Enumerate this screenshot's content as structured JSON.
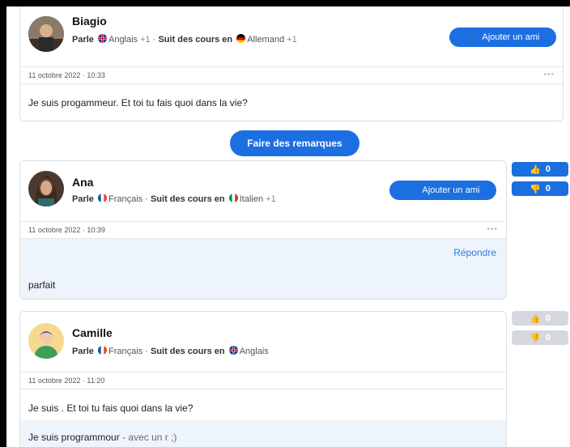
{
  "post1": {
    "name": "Biagio",
    "speaks_label": "Parle",
    "speaks_lang": "Anglais",
    "speaks_extra": "+1",
    "learning_label": "Suit des cours en",
    "learning_lang": "Allemand",
    "learning_extra": "+1",
    "add_friend": "Ajouter un ami",
    "timestamp": "11 octobre 2022 · 10:33",
    "message": "Je suis progammeur. Et toi tu fais quoi dans la vie?"
  },
  "feedback_button": "Faire des remarques",
  "post2": {
    "name": "Ana",
    "speaks_label": "Parle",
    "speaks_lang": "Français",
    "learning_label": "Suit des cours en",
    "learning_lang": "Italien",
    "learning_extra": "+1",
    "add_friend": "Ajouter un ami",
    "timestamp": "11 octobre 2022 · 10:39",
    "reply": "Répondre",
    "message": "parfait",
    "likes": "0",
    "dislikes": "0"
  },
  "post3": {
    "name": "Camille",
    "speaks_label": "Parle",
    "speaks_lang": "Français",
    "learning_label": "Suit des cours en",
    "learning_lang": "Anglais",
    "timestamp": "11 octobre 2022 · 11:20",
    "message": "Je suis . Et toi tu fais quoi dans la vie?",
    "correction_main": "Je suis programmour",
    "correction_note": "- avec un r ;)",
    "likes": "0",
    "dislikes": "0"
  },
  "colors": {
    "accent": "#1c6fe0",
    "inactive": "#d5d9de",
    "highlight_bg": "#eef4fb"
  }
}
